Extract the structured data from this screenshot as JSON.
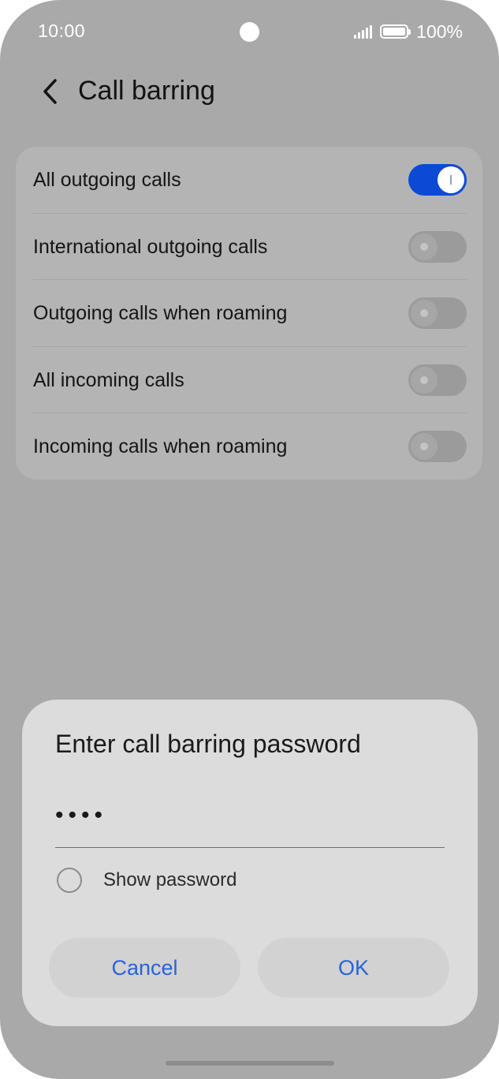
{
  "status_bar": {
    "time": "10:00",
    "battery": "100%"
  },
  "header": {
    "title": "Call barring"
  },
  "settings": {
    "items": [
      {
        "label": "All outgoing calls",
        "enabled": true
      },
      {
        "label": "International outgoing calls",
        "enabled": false
      },
      {
        "label": "Outgoing calls when roaming",
        "enabled": false
      },
      {
        "label": "All incoming calls",
        "enabled": false
      },
      {
        "label": "Incoming calls when roaming",
        "enabled": false
      }
    ]
  },
  "dialog": {
    "title": "Enter call barring password",
    "password_masked": "••••",
    "show_password_label": "Show password",
    "show_password_checked": false,
    "cancel_label": "Cancel",
    "ok_label": "OK"
  },
  "colors": {
    "accent": "#0c4ad6",
    "dialog_button_text": "#2a62d9",
    "scrim_background": "#a9a9a9"
  }
}
